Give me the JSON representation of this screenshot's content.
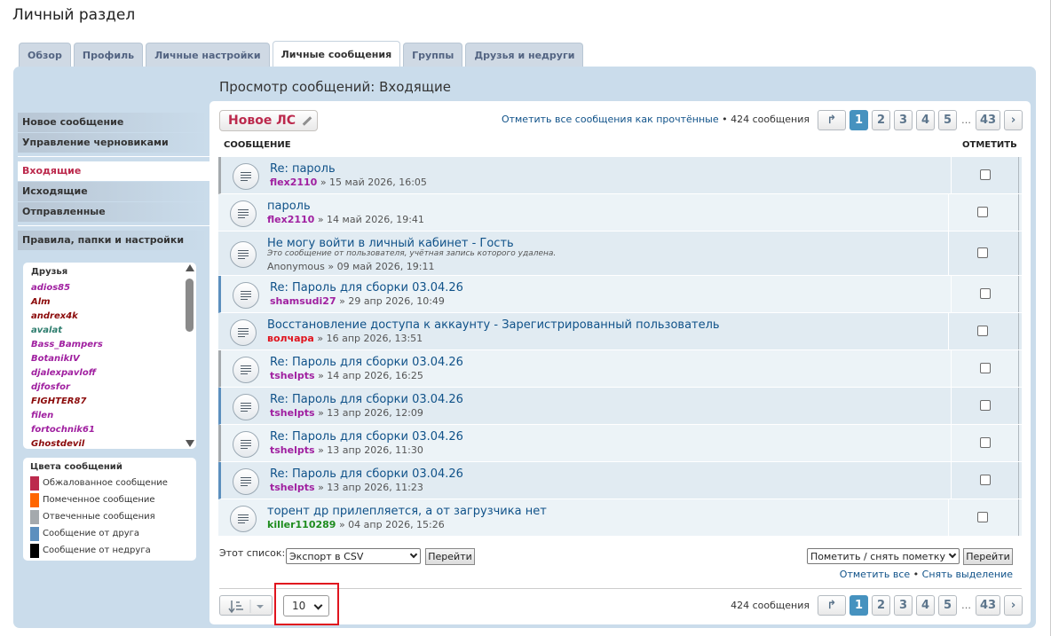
{
  "page_title": "Личный раздел",
  "tabs": [
    "Обзор",
    "Профиль",
    "Личные настройки",
    "Личные сообщения",
    "Группы",
    "Друзья и недруги"
  ],
  "heading": "Просмотр сообщений: Входящие",
  "menu": {
    "new": "Новое сообщение",
    "drafts": "Управление черновиками",
    "inbox": "Входящие",
    "outbox": "Исходящие",
    "sent": "Отправленные",
    "rules": "Правила, папки и настройки"
  },
  "friends": {
    "title": "Друзья",
    "items": [
      {
        "name": "adios85",
        "color": "#a020a0"
      },
      {
        "name": "Alm",
        "color": "#8b0a0a"
      },
      {
        "name": "andrex4k",
        "color": "#8b0a0a"
      },
      {
        "name": "avalat",
        "color": "#2e7d6e"
      },
      {
        "name": "Bass_Bampers",
        "color": "#a020a0"
      },
      {
        "name": "BotanikIV",
        "color": "#a020a0"
      },
      {
        "name": "djalexpavloff",
        "color": "#a020a0"
      },
      {
        "name": "djfosfor",
        "color": "#a020a0"
      },
      {
        "name": "FIGHTER87",
        "color": "#8b0a0a"
      },
      {
        "name": "filen",
        "color": "#a020a0"
      },
      {
        "name": "fortochnik61",
        "color": "#a020a0"
      },
      {
        "name": "Ghostdevil",
        "color": "#8b0a0a"
      }
    ]
  },
  "legend": {
    "title": "Цвета сообщений",
    "items": [
      {
        "label": "Обжалованное сообщение",
        "color": "#bc2a4d"
      },
      {
        "label": "Помеченное сообщение",
        "color": "#ff6600"
      },
      {
        "label": "Отвеченные сообщения",
        "color": "#a4a9ad"
      },
      {
        "label": "Сообщение от друга",
        "color": "#5c8fbe"
      },
      {
        "label": "Сообщение от недруга",
        "color": "#000000"
      }
    ]
  },
  "new_pm": "Новое ЛС",
  "mark_all_read": "Отметить все сообщения как прочтённые",
  "count_text": "424 сообщения",
  "pages": [
    "1",
    "2",
    "3",
    "4",
    "5",
    "43"
  ],
  "ellipsis": "…",
  "col_message": "СООБЩЕНИЕ",
  "col_mark": "ОТМЕТИТЬ",
  "messages": [
    {
      "title": "Re: пароль",
      "author": "flex2110",
      "author_color": "#a020a0",
      "date": "» 15 май 2026, 16:05",
      "kind": "ans"
    },
    {
      "title": "пароль",
      "author": "flex2110",
      "author_color": "#a020a0",
      "date": "» 14 май 2026, 19:41",
      "kind": "none"
    },
    {
      "title": "Не могу войти в личный кабинет - Гость",
      "sub": "Это сообщение от пользователя, учётная запись которого удалена.",
      "author": "Anonymous",
      "author_color": "#555555",
      "date": "» 09 май 2026, 19:11",
      "kind": "none"
    },
    {
      "title": "Re: Пароль для сборки 03.04.26",
      "author": "shamsudi27",
      "author_color": "#a020a0",
      "date": "» 29 апр 2026, 10:49",
      "kind": "fr"
    },
    {
      "title": "Восстановление доступа к аккаунту - Зарегистрированный пользователь",
      "author": "волчара",
      "author_color": "#e0141e",
      "date": "» 16 апр 2026, 13:51",
      "kind": "none"
    },
    {
      "title": "Re: Пароль для сборки 03.04.26",
      "author": "tshelpts",
      "author_color": "#a020a0",
      "date": "» 14 апр 2026, 16:25",
      "kind": "ans"
    },
    {
      "title": "Re: Пароль для сборки 03.04.26",
      "author": "tshelpts",
      "author_color": "#a020a0",
      "date": "» 13 апр 2026, 12:09",
      "kind": "fr"
    },
    {
      "title": "Re: Пароль для сборки 03.04.26",
      "author": "tshelpts",
      "author_color": "#a020a0",
      "date": "» 13 апр 2026, 11:30",
      "kind": "ans"
    },
    {
      "title": "Re: Пароль для сборки 03.04.26",
      "author": "tshelpts",
      "author_color": "#a020a0",
      "date": "» 13 апр 2026, 11:23",
      "kind": "fr"
    },
    {
      "title": "торент др прилепляется, а от загрузчика нет",
      "author": "killer110289",
      "author_color": "#1e8c1e",
      "date": "» 04 апр 2026, 15:26",
      "kind": "none"
    }
  ],
  "list_label": "Этот список:",
  "export_select": "Экспорт в CSV",
  "go": "Перейти",
  "mark_select": "Пометить / снять пометку",
  "mark_all": "Отметить все",
  "unmark": "Снять выделение",
  "bullet": "•",
  "per_page": "10"
}
